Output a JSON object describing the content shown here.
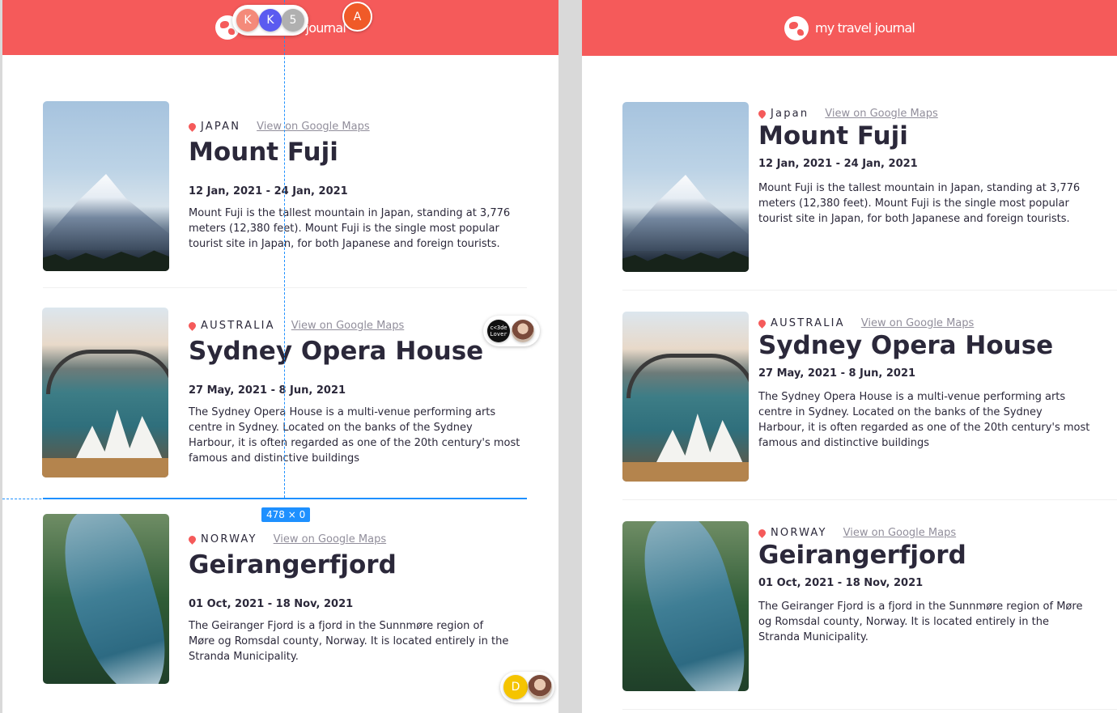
{
  "brand": "my travel journal",
  "entries": [
    {
      "country": "JAPAN",
      "maps_label": "View on Google Maps",
      "title": "Mount Fuji",
      "dates": "12 Jan, 2021 - 24 Jan, 2021",
      "desc": "Mount Fuji is the tallest mountain in Japan, standing at 3,776 meters (12,380 feet). Mount Fuji is the single most popular tourist site in Japan, for both Japanese and foreign tourists."
    },
    {
      "country": "AUSTRALIA",
      "maps_label": "View on Google Maps",
      "title": "Sydney Opera House",
      "dates": "27 May, 2021 - 8 Jun, 2021",
      "desc": "The Sydney Opera House is a multi-venue performing arts centre in Sydney. Located on the banks of the Sydney Harbour, it is often regarded as one of the 20th century's most famous and distinctive buildings"
    },
    {
      "country": "NORWAY",
      "maps_label": "View on Google Maps",
      "title": "Geirangerfjord",
      "dates": "01 Oct, 2021 - 18 Nov, 2021",
      "desc": "The Geiranger Fjord is a fjord in the Sunnmøre region of Møre og Romsdal county, Norway. It is located entirely in the Stranda Municipality."
    }
  ],
  "right_countries": [
    "Japan",
    "AUSTRALIA",
    "NORWAY"
  ],
  "collab": {
    "top": [
      "K",
      "K",
      "5"
    ],
    "solo": "A",
    "side_text": "c<3de Lover",
    "bottom": "D"
  },
  "measure": "478 × 0",
  "colors": {
    "accent": "#f55a5a",
    "guide": "#1e90ff"
  }
}
